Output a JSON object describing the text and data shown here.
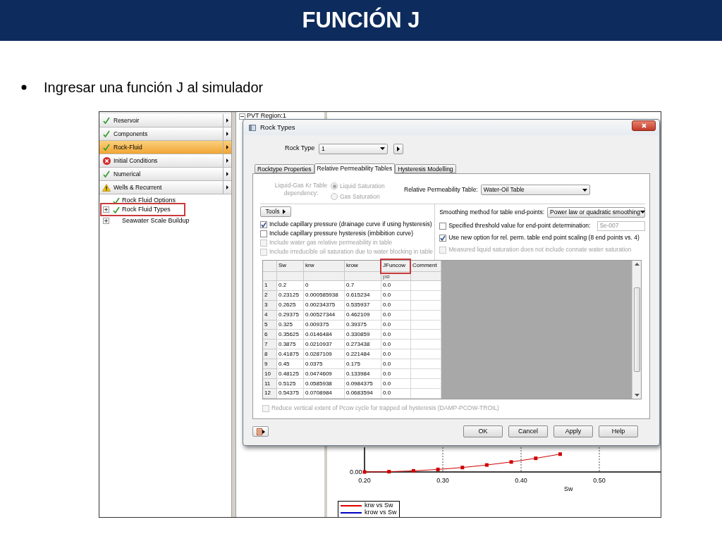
{
  "slide": {
    "title": "FUNCIÓN J",
    "bullets": [
      "Ingresar una función J al simulador"
    ]
  },
  "app": {
    "nav_items": [
      {
        "label": "Reservoir",
        "kind": "ok",
        "selected": false
      },
      {
        "label": "Components",
        "kind": "ok",
        "selected": false
      },
      {
        "label": "Rock-Fluid",
        "kind": "ok",
        "selected": true
      },
      {
        "label": "Initial Conditions",
        "kind": "error",
        "selected": false
      },
      {
        "label": "Numerical",
        "kind": "ok",
        "selected": false
      },
      {
        "label": "Wells & Recurrent",
        "kind": "warning",
        "selected": false
      }
    ],
    "tree_items": [
      {
        "label": "Rock Fluid Options",
        "kind": "ok",
        "expandable": false,
        "annotated": false
      },
      {
        "label": "Rock Fluid Types",
        "kind": "ok",
        "expandable": true,
        "annotated": true
      },
      {
        "label": "Seawater Scale Buildup",
        "kind": "plain",
        "expandable": true,
        "annotated": false
      }
    ],
    "middle_pane": {
      "tree_item": "PVT Region:1"
    },
    "chart": {
      "x_tick_labels": [
        "0.20",
        "0.30",
        "0.40",
        "0.50"
      ],
      "y_tick_labels": [
        "0.00"
      ],
      "x_axis_label": "Sw",
      "legend": [
        {
          "label": "krw vs Sw",
          "color": "#e00000"
        },
        {
          "label": "krow vs Sw",
          "color": "#0000c0"
        }
      ]
    }
  },
  "dialog": {
    "title": "Rock Types",
    "rock_type": {
      "label": "Rock Type",
      "value": "1"
    },
    "tabs": [
      {
        "label": "Rocktype Properties",
        "selected": false
      },
      {
        "label": "Relative Permeability Tables",
        "selected": true
      },
      {
        "label": "Hysteresis Modelling",
        "selected": false
      }
    ],
    "kr_dependency": {
      "label": "Liquid-Gas Kr Table dependency:",
      "disabled": true,
      "options": [
        {
          "label": "Liquid Saturation",
          "selected": true
        },
        {
          "label": "Gas Saturation",
          "selected": false
        }
      ]
    },
    "rel_perm_table": {
      "label": "Relative Permeability Table:",
      "value": "Water-Oil Table"
    },
    "tools_button": "Tools",
    "left_options": [
      {
        "label": "Include capillary pressure (drainage curve if using hysteresis)",
        "checked": true,
        "disabled": false
      },
      {
        "label": "Include capillary pressure hysteresis (imbibition curve)",
        "checked": false,
        "disabled": false
      },
      {
        "label": "Include water gas relative permeability in table",
        "checked": false,
        "disabled": true
      },
      {
        "label": "Include irreducible oil saturation due to water blocking in table",
        "checked": false,
        "disabled": true
      }
    ],
    "smoothing": {
      "label": "Smoothing method for table end-points:",
      "value": "Power law or quadratic smoothing"
    },
    "right_options": [
      {
        "label": "Specified threshold value for end-point determination:",
        "checked": false,
        "disabled": false,
        "field_value": "5e-007"
      },
      {
        "label": "Use new option for rel. perm. table end point scaling (8 end points vs. 4)",
        "checked": true,
        "disabled": false
      },
      {
        "label": "Measured liquid saturation does not include connate water saturation",
        "checked": false,
        "disabled": true
      }
    ],
    "table": {
      "columns": [
        {
          "label": "Sw",
          "annotated": false
        },
        {
          "label": "krw",
          "annotated": false
        },
        {
          "label": "krow",
          "annotated": false
        },
        {
          "label": "JFuncow",
          "unit": "psi",
          "annotated": true
        },
        {
          "label": "Comment",
          "annotated": false
        }
      ],
      "rows": [
        {
          "number": "1",
          "cells": [
            "0.2",
            "0",
            "0.7",
            "0.0"
          ]
        },
        {
          "number": "2",
          "cells": [
            "0.23125",
            "0.000585938",
            "0.615234",
            "0.0"
          ]
        },
        {
          "number": "3",
          "cells": [
            "0.2625",
            "0.00234375",
            "0.535937",
            "0.0"
          ]
        },
        {
          "number": "4",
          "cells": [
            "0.29375",
            "0.00527344",
            "0.462109",
            "0.0"
          ]
        },
        {
          "number": "5",
          "cells": [
            "0.325",
            "0.009375",
            "0.39375",
            "0.0"
          ]
        },
        {
          "number": "6",
          "cells": [
            "0.35625",
            "0.0146484",
            "0.330859",
            "0.0"
          ]
        },
        {
          "number": "7",
          "cells": [
            "0.3875",
            "0.0210937",
            "0.273438",
            "0.0"
          ]
        },
        {
          "number": "8",
          "cells": [
            "0.41875",
            "0.0287109",
            "0.221484",
            "0.0"
          ]
        },
        {
          "number": "9",
          "cells": [
            "0.45",
            "0.0375",
            "0.175",
            "0.0"
          ]
        },
        {
          "number": "10",
          "cells": [
            "0.48125",
            "0.0474609",
            "0.133984",
            "0.0"
          ]
        },
        {
          "number": "11",
          "cells": [
            "0.5125",
            "0.0585938",
            "0.0984375",
            "0.0"
          ]
        },
        {
          "number": "12",
          "cells": [
            "0.54375",
            "0.0708984",
            "0.0683594",
            "0.0"
          ]
        }
      ]
    },
    "bottom_option": {
      "label": "Reduce vertical extent of Pcow cycle for trapped oil hysteresis (DAMP-PCOW-TROIL)",
      "checked": false,
      "disabled": true
    },
    "buttons": [
      "OK",
      "Cancel",
      "Apply",
      "Help"
    ]
  }
}
